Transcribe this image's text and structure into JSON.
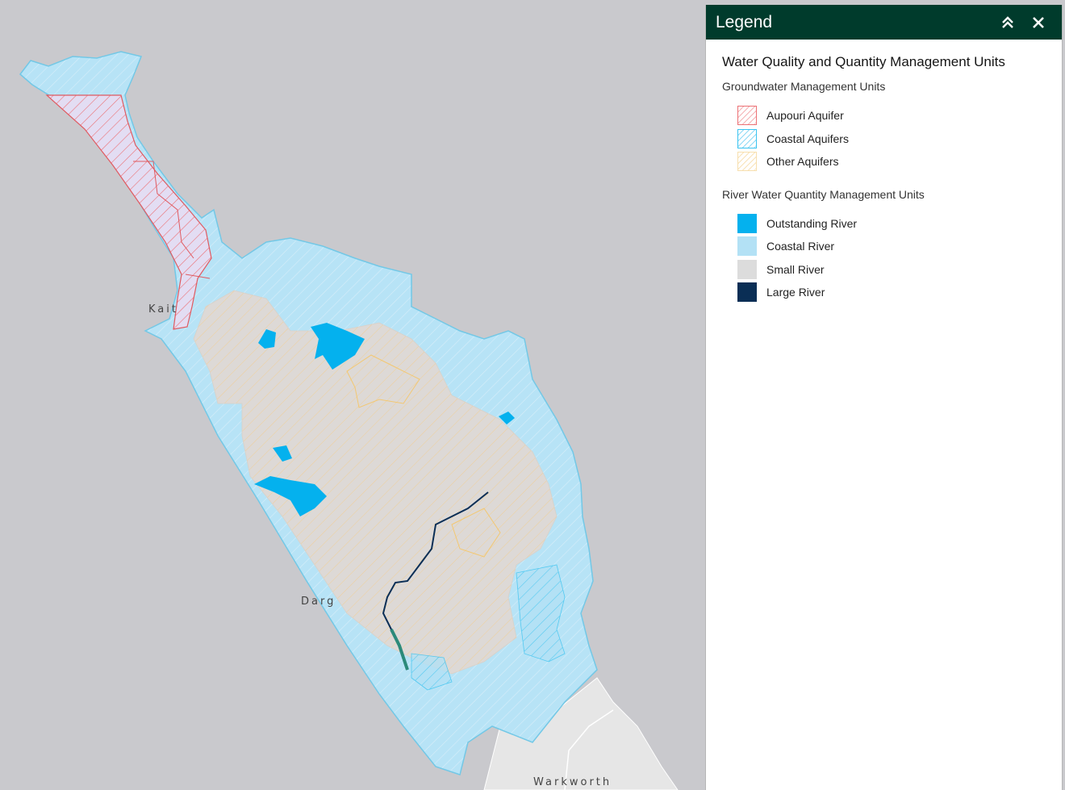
{
  "map": {
    "place_labels": [
      "Kait",
      "Darg",
      "Warkworth"
    ],
    "colors": {
      "background": "#c9c9cd",
      "coastal_river": "#b3e1f5",
      "small_river": "#ddd9d6",
      "outstanding_river": "#04b1ee",
      "large_river": "#0a2e55",
      "aupouri_aquifer": "#ec7175",
      "coastal_aquifers": "#39c3f0",
      "other_aquifers": "#f3c872",
      "land_south": "#e6e6e6"
    }
  },
  "legend": {
    "title": "Legend",
    "collapse_icon": "double-chevron-up-icon",
    "close_icon": "close-icon",
    "layer_title": "Water Quality and Quantity Management Units",
    "groups": [
      {
        "title": "Groundwater Management Units",
        "items": [
          {
            "label": "Aupouri Aquifer",
            "color": "#ec7175",
            "style": "hatched"
          },
          {
            "label": "Coastal Aquifers",
            "color": "#39c3f0",
            "style": "hatched"
          },
          {
            "label": "Other Aquifers",
            "color": "#f3c872",
            "style": "hatched"
          }
        ]
      },
      {
        "title": "River Water Quantity Management Units",
        "items": [
          {
            "label": "Outstanding River",
            "color": "#04b1ee",
            "style": "solid"
          },
          {
            "label": "Coastal River",
            "color": "#b3e1f5",
            "style": "solid"
          },
          {
            "label": "Small River",
            "color": "#dcdcdc",
            "style": "solid"
          },
          {
            "label": "Large River",
            "color": "#0a2e55",
            "style": "solid"
          }
        ]
      }
    ]
  }
}
